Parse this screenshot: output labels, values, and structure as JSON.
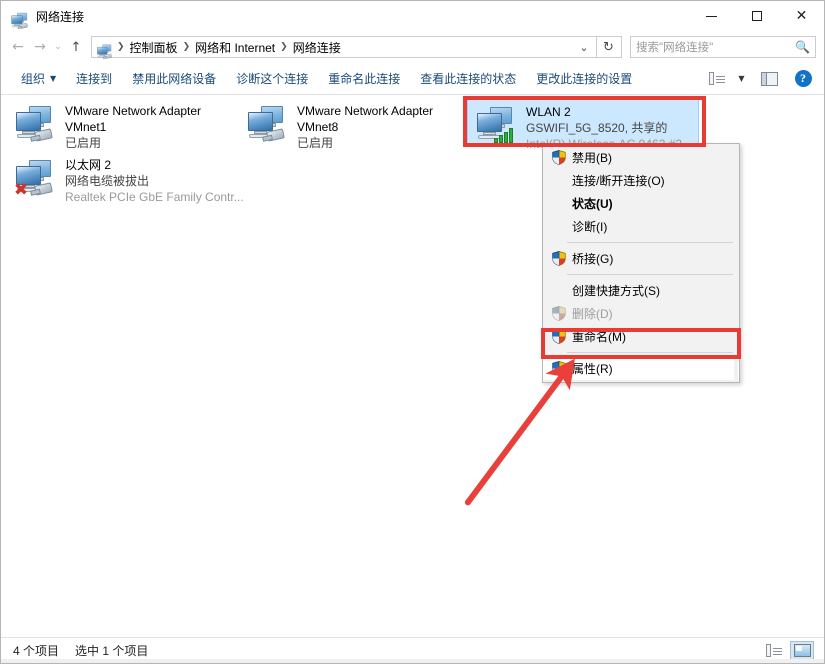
{
  "window": {
    "title": "网络连接",
    "title_icon": "network-connections-icon",
    "controls": {
      "minimize": "minimize-button",
      "maximize": "maximize-button",
      "close": "close-button"
    }
  },
  "addressbar": {
    "back": "back-button",
    "forward": "forward-button",
    "history": "history-dropdown",
    "up": "up-button",
    "icon": "network-connections-icon",
    "crumbs": [
      "控制面板",
      "网络和 Internet",
      "网络连接"
    ],
    "separator": "›",
    "dropdown": "chevron-down-icon",
    "refresh": "refresh-icon"
  },
  "search": {
    "placeholder": "搜索\"网络连接\"",
    "icon": "search-icon"
  },
  "commandbar": {
    "items": [
      {
        "label": "组织",
        "has_caret": true
      },
      {
        "label": "连接到",
        "has_caret": false
      },
      {
        "label": "禁用此网络设备",
        "has_caret": false
      },
      {
        "label": "诊断这个连接",
        "has_caret": false
      },
      {
        "label": "重命名此连接",
        "has_caret": false
      },
      {
        "label": "查看此连接的状态",
        "has_caret": false
      },
      {
        "label": "更改此连接的设置",
        "has_caret": false
      }
    ],
    "view_button": "change-view-icon",
    "view_caret": "chevron-down-icon",
    "preview_pane_button": "preview-pane-icon",
    "help_button": "help-icon",
    "help_glyph": "?"
  },
  "adapters": [
    {
      "name": "VMware Network Adapter",
      "name2": "VMnet1",
      "status": "已启用",
      "device": "",
      "icon": "network-adapter-icon",
      "selected": false,
      "disconnected": false,
      "wifi": false
    },
    {
      "name": "VMware Network Adapter",
      "name2": "VMnet8",
      "status": "已启用",
      "device": "",
      "icon": "network-adapter-icon",
      "selected": false,
      "disconnected": false,
      "wifi": false
    },
    {
      "name": "以太网 2",
      "name2": "",
      "status": "网络电缆被拔出",
      "device": "Realtek PCIe GbE Family Contr...",
      "icon": "network-adapter-disconnected-icon",
      "selected": false,
      "disconnected": true,
      "wifi": false
    },
    {
      "name": "WLAN 2",
      "name2": "",
      "status": "GSWIFI_5G_8520, 共享的",
      "device": "Intel(R) Wireless-AC 9462 #2",
      "icon": "wireless-adapter-icon",
      "selected": true,
      "disconnected": false,
      "wifi": true
    }
  ],
  "contextmenu": {
    "items": [
      {
        "label": "禁用(B)",
        "shield": true,
        "bold": false,
        "disabled": false,
        "highlighted": false
      },
      {
        "label": "连接/断开连接(O)",
        "shield": false,
        "bold": false,
        "disabled": false,
        "highlighted": false
      },
      {
        "label": "状态(U)",
        "shield": false,
        "bold": true,
        "disabled": false,
        "highlighted": false
      },
      {
        "label": "诊断(I)",
        "shield": false,
        "bold": false,
        "disabled": false,
        "highlighted": false
      },
      {
        "separator": true
      },
      {
        "label": "桥接(G)",
        "shield": true,
        "bold": false,
        "disabled": false,
        "highlighted": false
      },
      {
        "separator": true
      },
      {
        "label": "创建快捷方式(S)",
        "shield": false,
        "bold": false,
        "disabled": false,
        "highlighted": false
      },
      {
        "label": "删除(D)",
        "shield": true,
        "bold": false,
        "disabled": true,
        "highlighted": false
      },
      {
        "label": "重命名(M)",
        "shield": true,
        "bold": false,
        "disabled": false,
        "highlighted": false
      },
      {
        "separator": true
      },
      {
        "label": "属性(R)",
        "shield": true,
        "bold": false,
        "disabled": false,
        "highlighted": true
      }
    ]
  },
  "annotations": {
    "highlight_color": "#e83b33",
    "arrow_color": "#e8403a",
    "boxes": [
      {
        "name": "wlan-highlight-box"
      },
      {
        "name": "properties-highlight-box"
      }
    ],
    "arrow": "pointer-arrow"
  },
  "statusbar": {
    "item_count": "4 个项目",
    "selection": "选中 1 个项目",
    "details_view_button": "details-view-icon",
    "tiles_view_button": "tiles-view-icon"
  },
  "colors": {
    "selection_blue": "#cce8ff",
    "link_blue": "#1a4b78",
    "annotation_red": "#e83b33"
  }
}
